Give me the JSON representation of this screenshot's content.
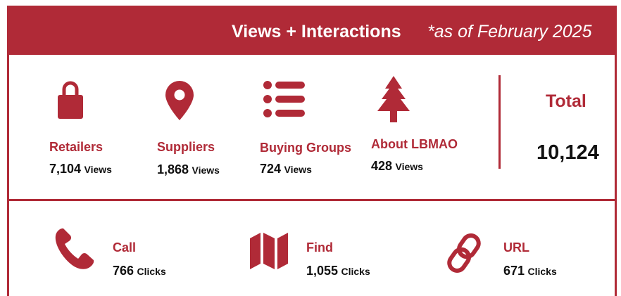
{
  "header": {
    "title": "Views + Interactions",
    "subtitle": "*as of February 2025"
  },
  "theme": {
    "accent": "#b02a37",
    "text": "#111111"
  },
  "views": [
    {
      "label": "Retailers",
      "count": "7,104",
      "unit": "Views",
      "icon": "shopping-bag-icon"
    },
    {
      "label": "Suppliers",
      "count": "1,868",
      "unit": "Views",
      "icon": "map-pin-icon"
    },
    {
      "label": "Buying Groups",
      "count": "724",
      "unit": "Views",
      "icon": "list-icon"
    },
    {
      "label": "About LBMAO",
      "count": "428",
      "unit": "Views",
      "icon": "pine-tree-icon"
    }
  ],
  "total": {
    "label": "Total",
    "value": "10,124"
  },
  "interactions": [
    {
      "label": "Call",
      "count": "766",
      "unit": "Clicks",
      "icon": "phone-icon"
    },
    {
      "label": "Find",
      "count": "1,055",
      "unit": "Clicks",
      "icon": "map-icon"
    },
    {
      "label": "URL",
      "count": "671",
      "unit": "Clicks",
      "icon": "link-icon"
    }
  ]
}
